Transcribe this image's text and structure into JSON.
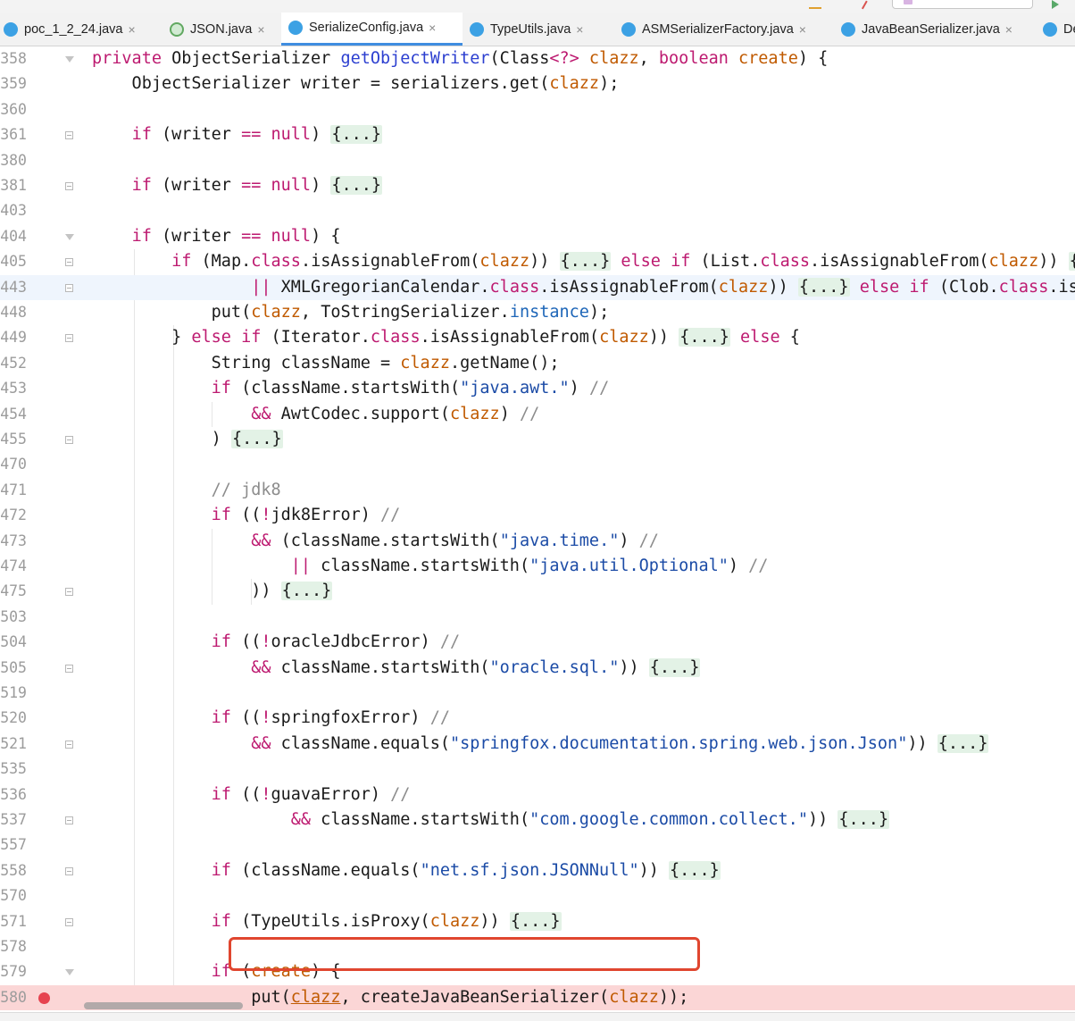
{
  "tabs": [
    {
      "label": "poc_1_2_24.java",
      "icon": "class-icon",
      "active": false
    },
    {
      "label": "JSON.java",
      "icon": "json-icon",
      "active": false
    },
    {
      "label": "SerializeConfig.java",
      "icon": "class-icon",
      "active": true
    },
    {
      "label": "TypeUtils.java",
      "icon": "class-icon",
      "active": false
    },
    {
      "label": "ASMSerializerFactory.java",
      "icon": "class-icon",
      "active": false
    },
    {
      "label": "JavaBeanSerializer.java",
      "icon": "class-icon",
      "active": false
    },
    {
      "label": "De",
      "icon": "class-icon",
      "active": false
    }
  ],
  "close_glyph": "×",
  "colors": {
    "active_tab_underline": "#3f8de0",
    "keyword": "#bd1a70",
    "parameter": "#c05a00",
    "string": "#1b4ba6",
    "breakpoint_line": "#fbd6d6",
    "breakpoint_dot": "#e6434f",
    "annotation_box": "#e0462f",
    "folded_block": "#e3f2e6"
  },
  "lines": [
    {
      "n": "358",
      "fold": "open",
      "tokens": [
        [
          "kw",
          "private "
        ],
        [
          "",
          "ObjectSerializer "
        ],
        [
          "fn",
          "getObjectWriter"
        ],
        [
          "",
          "(Class"
        ],
        [
          "kw",
          "<?>"
        ],
        [
          "par",
          " clazz"
        ],
        [
          "",
          ", "
        ],
        [
          "kw",
          "boolean "
        ],
        [
          "par",
          "create"
        ],
        [
          "",
          ") {"
        ]
      ]
    },
    {
      "n": "359",
      "tokens": [
        [
          "",
          "    ObjectSerializer writer = serializers.get("
        ],
        [
          "par",
          "clazz"
        ],
        [
          "",
          ");"
        ]
      ]
    },
    {
      "n": "360",
      "tokens": []
    },
    {
      "n": "361",
      "fold": "collapsed",
      "tokens": [
        [
          "",
          "    "
        ],
        [
          "kw",
          "if "
        ],
        [
          "",
          "(writer "
        ],
        [
          "kw",
          "=="
        ],
        [
          "kw",
          " null"
        ],
        [
          "",
          ") "
        ],
        [
          "fbox",
          "{...}"
        ]
      ]
    },
    {
      "n": "380",
      "tokens": []
    },
    {
      "n": "381",
      "fold": "collapsed",
      "tokens": [
        [
          "",
          "    "
        ],
        [
          "kw",
          "if "
        ],
        [
          "",
          "(writer "
        ],
        [
          "kw",
          "=="
        ],
        [
          "kw",
          " null"
        ],
        [
          "",
          ") "
        ],
        [
          "fbox",
          "{...}"
        ]
      ]
    },
    {
      "n": "403",
      "tokens": []
    },
    {
      "n": "404",
      "fold": "open",
      "tokens": [
        [
          "",
          "    "
        ],
        [
          "kw",
          "if "
        ],
        [
          "",
          "(writer "
        ],
        [
          "kw",
          "=="
        ],
        [
          "kw",
          " null"
        ],
        [
          "",
          ") {"
        ]
      ]
    },
    {
      "n": "405",
      "fold": "collapsed",
      "tokens": [
        [
          "",
          "        "
        ],
        [
          "kw",
          "if "
        ],
        [
          "",
          "(Map."
        ],
        [
          "kw",
          "class"
        ],
        [
          "",
          ".isAssignableFrom("
        ],
        [
          "par",
          "clazz"
        ],
        [
          "",
          ")) "
        ],
        [
          "fbox",
          "{...}"
        ],
        [
          "kw",
          " else if "
        ],
        [
          "",
          "(List."
        ],
        [
          "kw",
          "class"
        ],
        [
          "",
          ".isAssignableFrom("
        ],
        [
          "par",
          "clazz"
        ],
        [
          "",
          ")) "
        ],
        [
          "fbox",
          "{..."
        ]
      ]
    },
    {
      "n": "443",
      "fold": "collapsed",
      "caret": true,
      "tokens": [
        [
          "",
          "                "
        ],
        [
          "kw",
          "||"
        ],
        [
          "",
          " XMLGregorianCalendar."
        ],
        [
          "kw",
          "class"
        ],
        [
          "",
          ".isAssignableFrom("
        ],
        [
          "par",
          "clazz"
        ],
        [
          "",
          ")) "
        ],
        [
          "fbox",
          "{...}"
        ],
        [
          "kw",
          " else if "
        ],
        [
          "",
          "(Clob."
        ],
        [
          "kw",
          "class"
        ],
        [
          "",
          ".isAss"
        ]
      ]
    },
    {
      "n": "448",
      "tokens": [
        [
          "",
          "            put("
        ],
        [
          "par",
          "clazz"
        ],
        [
          "",
          ", ToStringSerializer."
        ],
        [
          "fld",
          "instance"
        ],
        [
          "",
          ");"
        ]
      ]
    },
    {
      "n": "449",
      "fold": "collapsed",
      "tokens": [
        [
          "",
          "        } "
        ],
        [
          "kw",
          "else if "
        ],
        [
          "",
          "(Iterator."
        ],
        [
          "kw",
          "class"
        ],
        [
          "",
          ".isAssignableFrom("
        ],
        [
          "par",
          "clazz"
        ],
        [
          "",
          ")) "
        ],
        [
          "fbox",
          "{...}"
        ],
        [
          "kw",
          " else "
        ],
        [
          "",
          "{"
        ]
      ]
    },
    {
      "n": "452",
      "tokens": [
        [
          "",
          "            String className = "
        ],
        [
          "par",
          "clazz"
        ],
        [
          "",
          ".getName();"
        ]
      ]
    },
    {
      "n": "453",
      "tokens": [
        [
          "",
          "            "
        ],
        [
          "kw",
          "if "
        ],
        [
          "",
          "(className.startsWith("
        ],
        [
          "str",
          "\"java.awt.\""
        ],
        [
          "",
          ") "
        ],
        [
          "com",
          "//"
        ]
      ]
    },
    {
      "n": "454",
      "tokens": [
        [
          "",
          "                "
        ],
        [
          "kw",
          "&&"
        ],
        [
          "",
          " AwtCodec.support("
        ],
        [
          "par",
          "clazz"
        ],
        [
          "",
          ") "
        ],
        [
          "com",
          "//"
        ]
      ]
    },
    {
      "n": "455",
      "fold": "collapsed",
      "tokens": [
        [
          "",
          "            ) "
        ],
        [
          "fbox",
          "{...}"
        ]
      ]
    },
    {
      "n": "470",
      "tokens": []
    },
    {
      "n": "471",
      "tokens": [
        [
          "",
          "            "
        ],
        [
          "com",
          "// jdk8"
        ]
      ]
    },
    {
      "n": "472",
      "tokens": [
        [
          "",
          "            "
        ],
        [
          "kw",
          "if "
        ],
        [
          "",
          "(("
        ],
        [
          "kw",
          "!"
        ],
        [
          "",
          "jdk8Error) "
        ],
        [
          "com",
          "//"
        ]
      ]
    },
    {
      "n": "473",
      "tokens": [
        [
          "",
          "                "
        ],
        [
          "kw",
          "&&"
        ],
        [
          "",
          " (className.startsWith("
        ],
        [
          "str",
          "\"java.time.\""
        ],
        [
          "",
          ") "
        ],
        [
          "com",
          "//"
        ]
      ]
    },
    {
      "n": "474",
      "tokens": [
        [
          "",
          "                    "
        ],
        [
          "kw",
          "||"
        ],
        [
          "",
          " className.startsWith("
        ],
        [
          "str",
          "\"java.util.Optional\""
        ],
        [
          "",
          ") "
        ],
        [
          "com",
          "//"
        ]
      ]
    },
    {
      "n": "475",
      "fold": "collapsed",
      "tokens": [
        [
          "",
          "                )) "
        ],
        [
          "fbox",
          "{...}"
        ]
      ]
    },
    {
      "n": "503",
      "tokens": []
    },
    {
      "n": "504",
      "tokens": [
        [
          "",
          "            "
        ],
        [
          "kw",
          "if "
        ],
        [
          "",
          "(("
        ],
        [
          "kw",
          "!"
        ],
        [
          "",
          "oracleJdbcError) "
        ],
        [
          "com",
          "//"
        ]
      ]
    },
    {
      "n": "505",
      "fold": "collapsed",
      "tokens": [
        [
          "",
          "                "
        ],
        [
          "kw",
          "&&"
        ],
        [
          "",
          " className.startsWith("
        ],
        [
          "str",
          "\"oracle.sql.\""
        ],
        [
          "",
          ")) "
        ],
        [
          "fbox",
          "{...}"
        ]
      ]
    },
    {
      "n": "519",
      "tokens": []
    },
    {
      "n": "520",
      "tokens": [
        [
          "",
          "            "
        ],
        [
          "kw",
          "if "
        ],
        [
          "",
          "(("
        ],
        [
          "kw",
          "!"
        ],
        [
          "",
          "springfoxError) "
        ],
        [
          "com",
          "//"
        ]
      ]
    },
    {
      "n": "521",
      "fold": "collapsed",
      "tokens": [
        [
          "",
          "                "
        ],
        [
          "kw",
          "&&"
        ],
        [
          "",
          " className.equals("
        ],
        [
          "str",
          "\"springfox.documentation.spring.web.json.Json\""
        ],
        [
          "",
          ")) "
        ],
        [
          "fbox",
          "{...}"
        ]
      ]
    },
    {
      "n": "535",
      "tokens": []
    },
    {
      "n": "536",
      "tokens": [
        [
          "",
          "            "
        ],
        [
          "kw",
          "if "
        ],
        [
          "",
          "(("
        ],
        [
          "kw",
          "!"
        ],
        [
          "",
          "guavaError) "
        ],
        [
          "com",
          "//"
        ]
      ]
    },
    {
      "n": "537",
      "fold": "collapsed",
      "tokens": [
        [
          "",
          "                    "
        ],
        [
          "kw",
          "&&"
        ],
        [
          "",
          " className.startsWith("
        ],
        [
          "str",
          "\"com.google.common.collect.\""
        ],
        [
          "",
          ")) "
        ],
        [
          "fbox",
          "{...}"
        ]
      ]
    },
    {
      "n": "557",
      "tokens": []
    },
    {
      "n": "558",
      "fold": "collapsed",
      "tokens": [
        [
          "",
          "            "
        ],
        [
          "kw",
          "if "
        ],
        [
          "",
          "(className.equals("
        ],
        [
          "str",
          "\"net.sf.json.JSONNull\""
        ],
        [
          "",
          ")) "
        ],
        [
          "fbox",
          "{...}"
        ]
      ]
    },
    {
      "n": "570",
      "tokens": []
    },
    {
      "n": "571",
      "fold": "collapsed",
      "tokens": [
        [
          "",
          "            "
        ],
        [
          "kw",
          "if "
        ],
        [
          "",
          "(TypeUtils.isProxy("
        ],
        [
          "par",
          "clazz"
        ],
        [
          "",
          ")) "
        ],
        [
          "fbox",
          "{...}"
        ]
      ]
    },
    {
      "n": "578",
      "tokens": []
    },
    {
      "n": "579",
      "fold": "open",
      "tokens": [
        [
          "",
          "            "
        ],
        [
          "kw",
          "if "
        ],
        [
          "",
          "("
        ],
        [
          "par",
          "create"
        ],
        [
          "",
          ") {"
        ]
      ]
    },
    {
      "n": "580",
      "breakpoint": true,
      "tokens": [
        [
          "",
          "                put("
        ],
        [
          "par",
          "clazz"
        ],
        [
          "",
          ", createJavaBeanSerializer("
        ],
        [
          "par",
          "clazz"
        ],
        [
          "",
          "));"
        ]
      ]
    }
  ]
}
